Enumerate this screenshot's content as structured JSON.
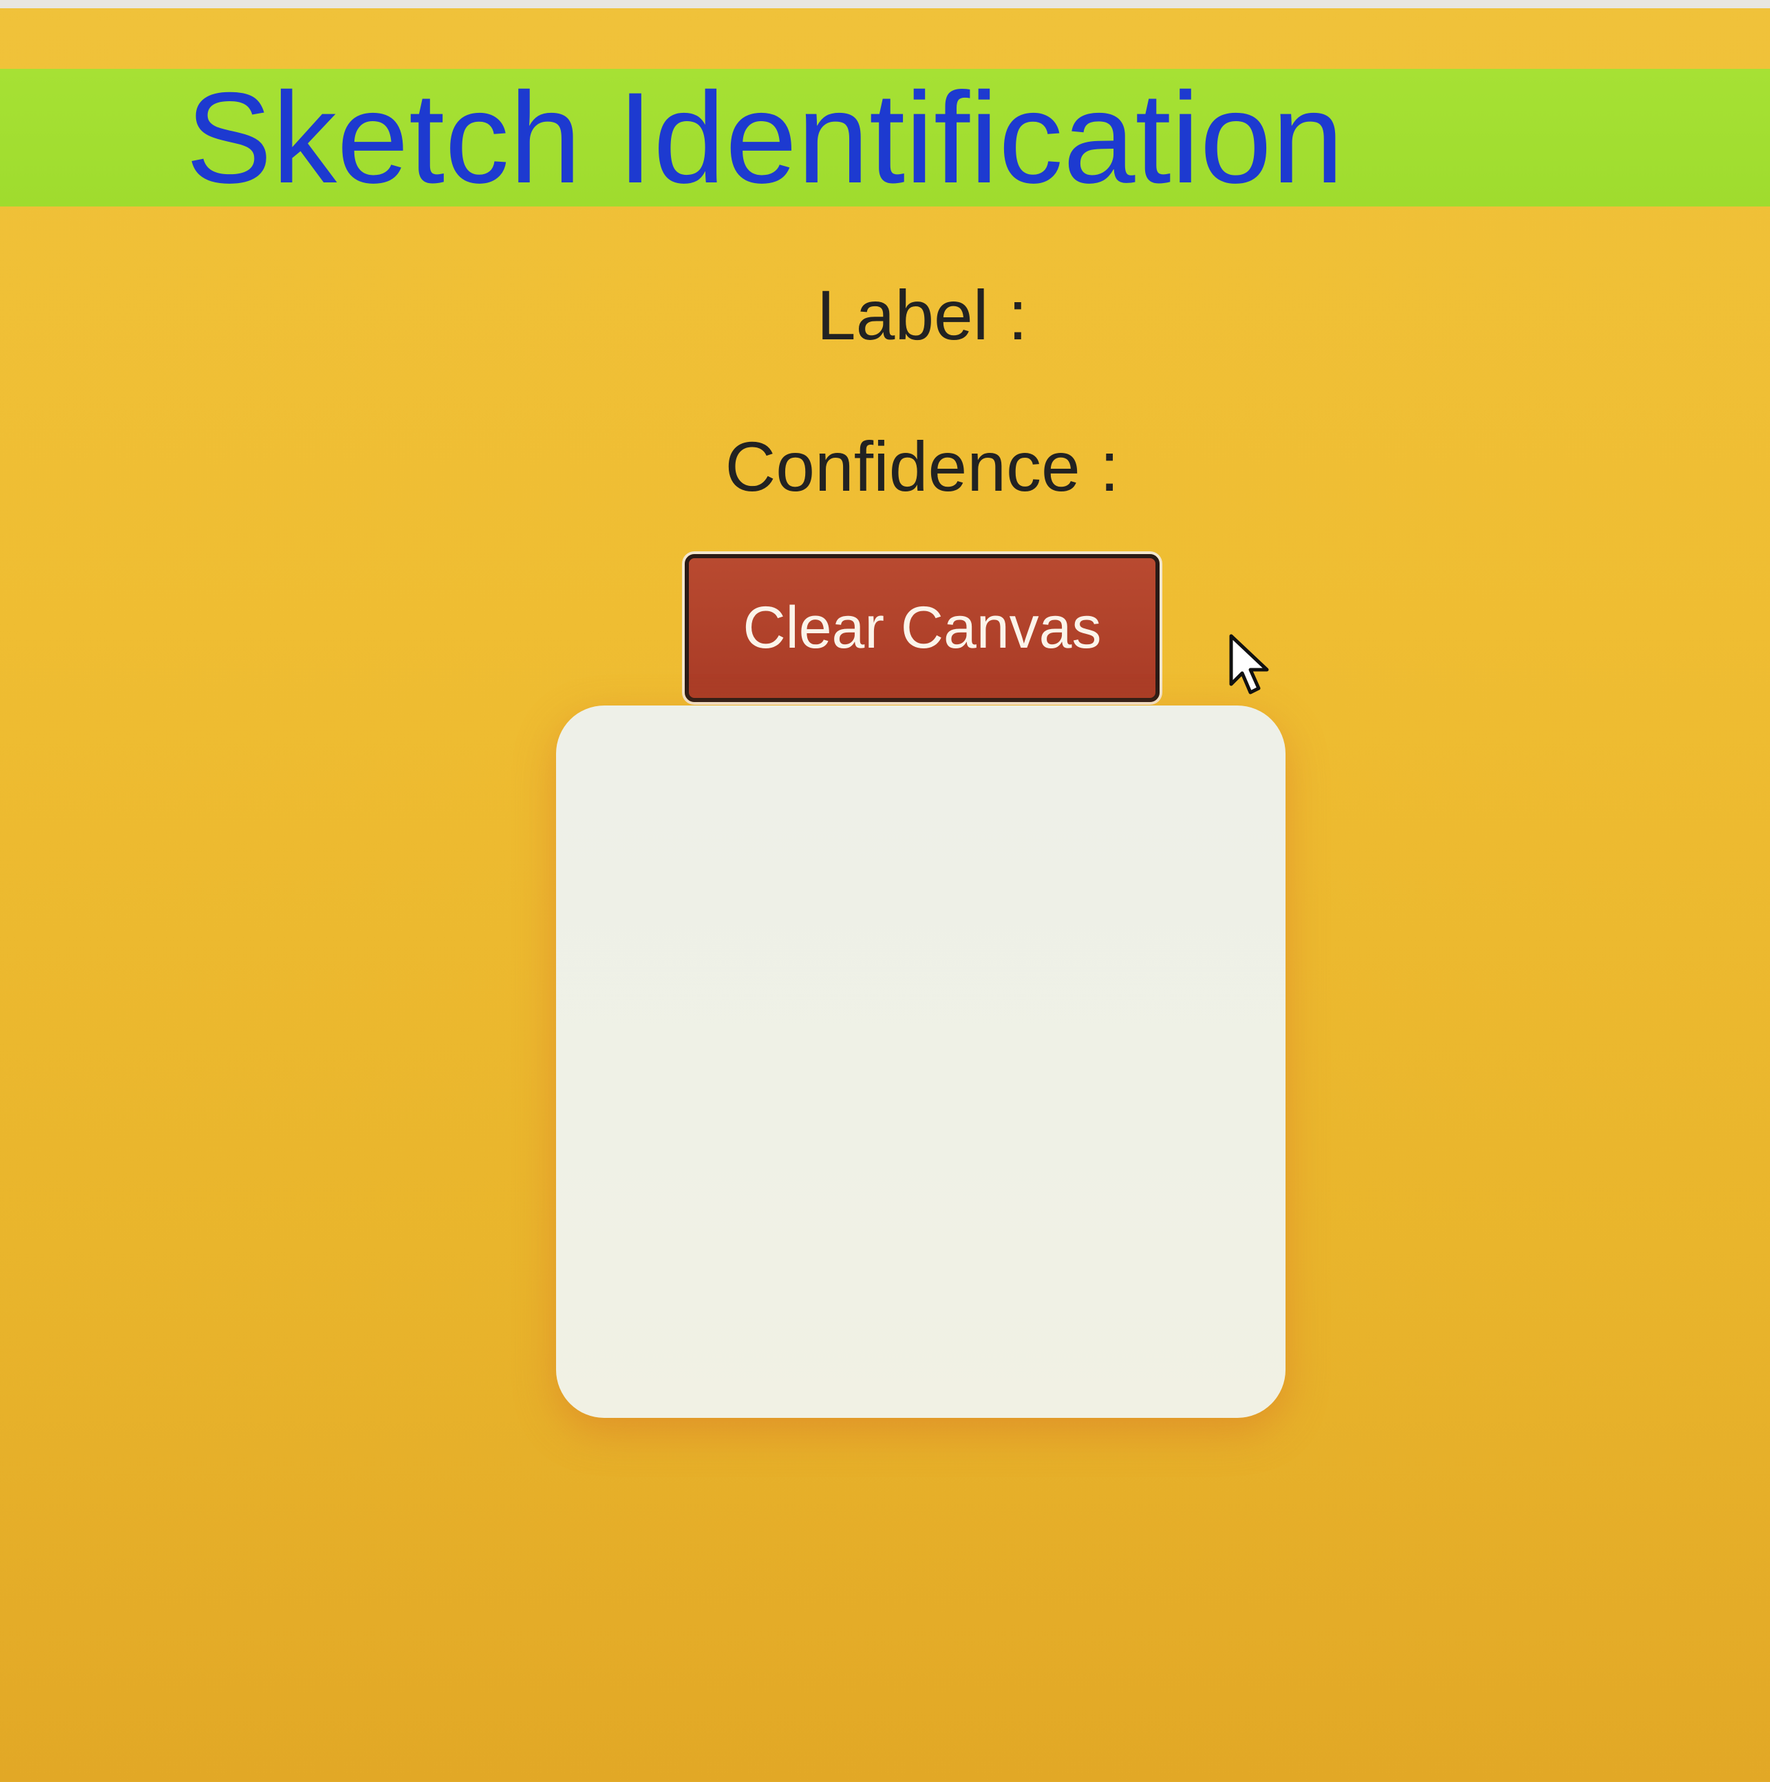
{
  "header": {
    "title": "Sketch Identification",
    "band_color": "#a6e134",
    "title_color": "#1d3ad0"
  },
  "results": {
    "label_text": "Label :",
    "confidence_text": "Confidence :"
  },
  "controls": {
    "clear_button_label": "Clear Canvas",
    "clear_button_color": "#b94a30"
  },
  "canvas": {
    "background": "#eef0e8"
  },
  "page": {
    "background": "#efbd32"
  },
  "icons": {
    "cursor": "mouse-pointer-icon"
  }
}
